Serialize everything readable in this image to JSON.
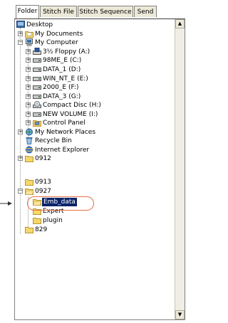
{
  "tabs": [
    "Folder",
    "Stitch File",
    "Stitch Sequence",
    "Send"
  ],
  "tree": {
    "desktop": "Desktop",
    "my_documents": "My Documents",
    "my_computer": "My Computer",
    "drives": [
      {
        "label": "3½ Floppy (A:)",
        "icon": "floppy-drive-icon"
      },
      {
        "label": "98ME_E (C:)",
        "icon": "hard-drive-icon"
      },
      {
        "label": "DATA_1 (D:)",
        "icon": "hard-drive-icon"
      },
      {
        "label": "WIN_NT_E (E:)",
        "icon": "hard-drive-icon"
      },
      {
        "label": "2000_E (F:)",
        "icon": "hard-drive-icon"
      },
      {
        "label": "DATA_3 (G:)",
        "icon": "hard-drive-icon"
      },
      {
        "label": "Compact Disc (H:)",
        "icon": "cd-drive-icon"
      },
      {
        "label": "NEW VOLUME (I:)",
        "icon": "hard-drive-icon"
      },
      {
        "label": "Control Panel",
        "icon": "control-panel-icon"
      }
    ],
    "network": "My Network Places",
    "recycle": "Recycle Bin",
    "ie": "Internet Explorer",
    "folders": {
      "f0912": "0912",
      "f0913": "0913",
      "f0927": "0927",
      "children": [
        "Emb_data",
        "Expert",
        "plugin"
      ],
      "f829": "829"
    }
  },
  "colors": {
    "selection": "#0a246a",
    "callout": "#e8704a",
    "folder": "#f5d76e"
  }
}
